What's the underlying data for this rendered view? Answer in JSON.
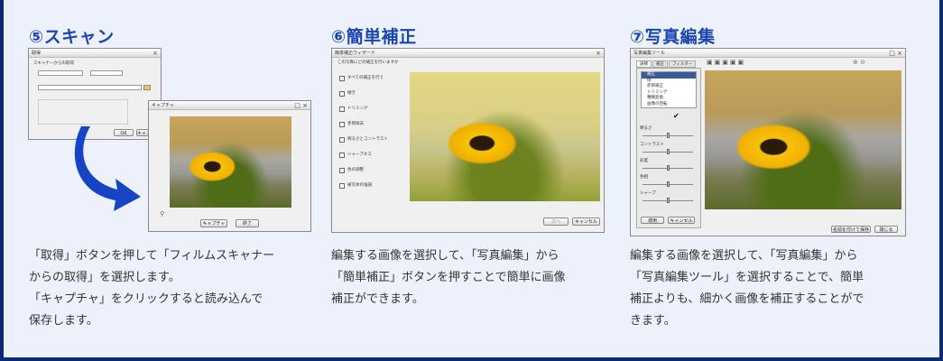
{
  "section5": {
    "title": "⑤スキャン",
    "desc": "「取得」ボタンを押して「フィルムスキャナー\nからの取得」を選択します。\n「キャプチャ」をクリックすると読み込んで\n保存します。",
    "dialog_title": "取得",
    "dialog_section": "スキャナーからの取得",
    "dialog_ok": "OK",
    "dialog_cancel": "キャンセル",
    "capture_title": "キャプチャ",
    "capture_button": "キャプチャ",
    "end_button": "終了"
  },
  "section6": {
    "title": "⑥簡単補正",
    "desc": "編集する画像を選択して、「写真編集」から\n「簡単補正」ボタンを押すことで簡単に画像\n補正ができます。",
    "window_title": "簡単補正ウィザード",
    "question": "この写真にどの補正を行いますか",
    "options": [
      "すべての補正を行う",
      "傾き",
      "トリミング",
      "赤目除去",
      "明るさとコントラスト",
      "シャープネス",
      "色の調整",
      "被写体の強調"
    ],
    "next_button": "次へ",
    "cancel_button": "キャンセル"
  },
  "section7": {
    "title": "⑦写真編集",
    "desc": "編集する画像を選択して、「写真編集」から\n「写真編集ツール」を選択することで、簡単\n補正よりも、細かく画像を補正することがで\nきます。",
    "window_title": "写真編集ツール",
    "tabs": [
      "調節",
      "補正",
      "フィルター"
    ],
    "tool_list": [
      "補正",
      "傾",
      "赤目補正",
      "トリミング",
      "種類変換",
      "画像の回転"
    ],
    "sliders": [
      "明るさ",
      "コントラスト",
      "彩度",
      "色相",
      "シャープ"
    ],
    "save_button": "名前を付けて保存",
    "close_button": "閉じる",
    "apply_button": "適用",
    "cancel_button": "キャンセル"
  },
  "colors": {
    "background": "#0a2a73",
    "panel": "#edf1fb",
    "title": "#1b46b0",
    "arrow": "#1545c5"
  }
}
